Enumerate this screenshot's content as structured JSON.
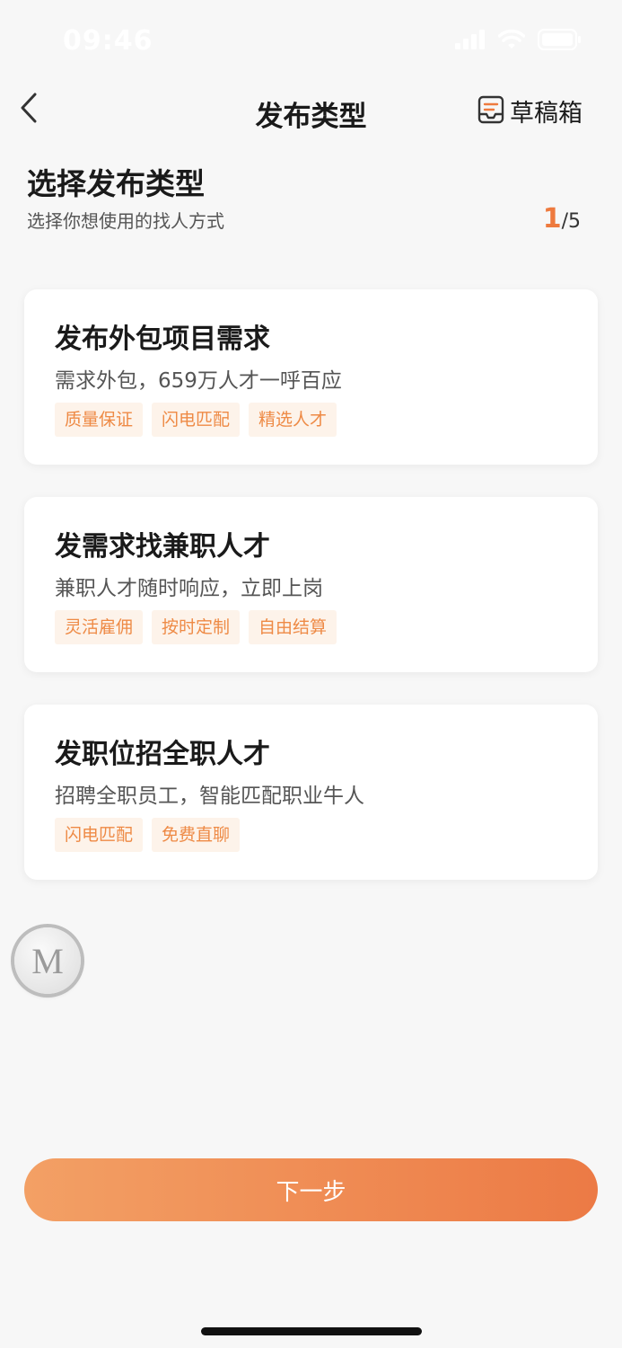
{
  "status_bar": {
    "time": "09:46"
  },
  "nav": {
    "title": "发布类型",
    "drafts_label": "草稿箱"
  },
  "header": {
    "title": "选择发布类型",
    "subtitle": "选择你想使用的找人方式",
    "step_current": "1",
    "step_total": "/5"
  },
  "cards": [
    {
      "title": "发布外包项目需求",
      "desc": "需求外包，659万人才一呼百应",
      "tags": [
        "质量保证",
        "闪电匹配",
        "精选人才"
      ]
    },
    {
      "title": "发需求找兼职人才",
      "desc": "兼职人才随时响应，立即上岗",
      "tags": [
        "灵活雇佣",
        "按时定制",
        "自由结算"
      ]
    },
    {
      "title": "发职位招全职人才",
      "desc": "招聘全职员工，智能匹配职业牛人",
      "tags": [
        "闪电匹配",
        "免费直聊"
      ]
    }
  ],
  "floating_button": {
    "letter": "M"
  },
  "footer": {
    "next_label": "下一步"
  },
  "colors": {
    "accent": "#ee7a3e",
    "tag_bg": "#fdf3ea",
    "tag_text": "#ee8a45",
    "button_gradient_start": "#f3a065",
    "button_gradient_end": "#ec7a45",
    "page_bg": "#f7f7f7"
  },
  "icons": {
    "back": "chevron-left-icon",
    "drafts": "drafts-box-icon",
    "signal": "signal-icon",
    "wifi": "wifi-icon",
    "battery": "battery-icon"
  }
}
